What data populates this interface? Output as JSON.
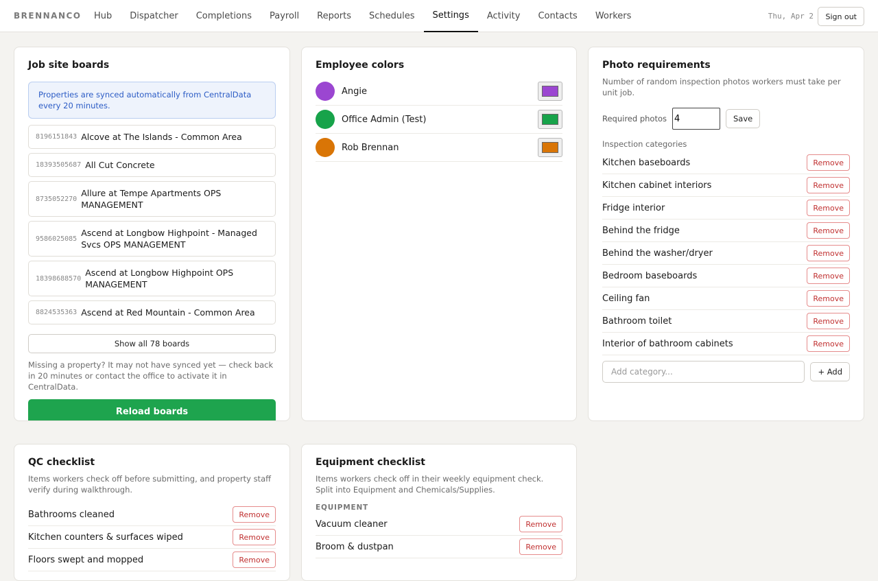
{
  "nav": {
    "brand": "BRENNANCO",
    "tabs": [
      "Hub",
      "Dispatcher",
      "Completions",
      "Payroll",
      "Reports",
      "Schedules",
      "Settings",
      "Activity",
      "Contacts",
      "Workers"
    ],
    "active_tab": "Settings",
    "date": "Thu, Apr 2",
    "signout_label": "Sign out"
  },
  "boards": {
    "title": "Job site boards",
    "info": "Properties are synced automatically from CentralData every 20 minutes.",
    "items": [
      {
        "id": "8196151843",
        "name": "Alcove at The Islands - Common Area"
      },
      {
        "id": "18393505687",
        "name": "All Cut Concrete"
      },
      {
        "id": "8735052270",
        "name": "Allure at Tempe Apartments OPS MANAGEMENT"
      },
      {
        "id": "9586025085",
        "name": "Ascend at Longbow Highpoint - Managed Svcs OPS MANAGEMENT"
      },
      {
        "id": "18398688570",
        "name": "Ascend at Longbow Highpoint OPS MANAGEMENT"
      },
      {
        "id": "8824535363",
        "name": "Ascend at Red Mountain - Common Area"
      }
    ],
    "show_all_label": "Show all 78 boards",
    "missing_note": "Missing a property? It may not have synced yet — check back in 20 minutes or contact the office to activate it in CentralData.",
    "reload_label": "Reload boards"
  },
  "employee_colors": {
    "title": "Employee colors",
    "items": [
      {
        "name": "Angie",
        "color": "#9b46d1"
      },
      {
        "name": "Office Admin (Test)",
        "color": "#17a34a"
      },
      {
        "name": "Rob Brennan",
        "color": "#d97506"
      }
    ]
  },
  "photo_requirements": {
    "title": "Photo requirements",
    "description": "Number of random inspection photos workers must take per unit job.",
    "required_label": "Required photos",
    "required_value": "4",
    "save_label": "Save",
    "categories_label": "Inspection categories",
    "categories": [
      "Kitchen baseboards",
      "Kitchen cabinet interiors",
      "Fridge interior",
      "Behind the fridge",
      "Behind the washer/dryer",
      "Bedroom baseboards",
      "Ceiling fan",
      "Bathroom toilet",
      "Interior of bathroom cabinets"
    ],
    "remove_label": "Remove",
    "add_placeholder": "Add category...",
    "add_label": "+ Add"
  },
  "qc_checklist": {
    "title": "QC checklist",
    "description": "Items workers check off before submitting, and property staff verify during walkthrough.",
    "items": [
      "Bathrooms cleaned",
      "Kitchen counters & surfaces wiped",
      "Floors swept and mopped"
    ],
    "remove_label": "Remove"
  },
  "equipment_checklist": {
    "title": "Equipment checklist",
    "description": "Items workers check off in their weekly equipment check. Split into Equipment and Chemicals/Supplies.",
    "section_label": "EQUIPMENT",
    "items": [
      "Vacuum cleaner",
      "Broom & dustpan"
    ],
    "remove_label": "Remove"
  }
}
